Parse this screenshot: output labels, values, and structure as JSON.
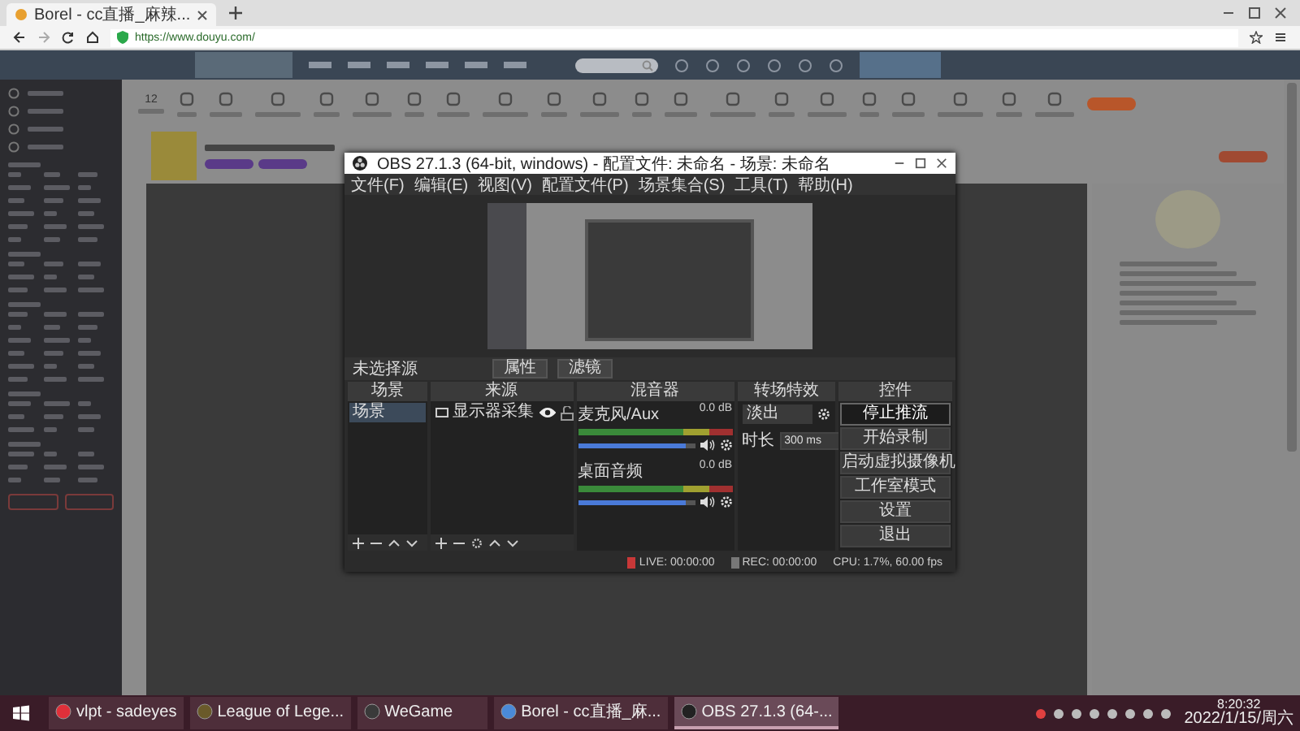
{
  "browser": {
    "tab_title": "Borel - cc直播_麻辣...",
    "url": "https://www.douyu.com/"
  },
  "site": {
    "stat": "12"
  },
  "obs": {
    "title": "OBS 27.1.3 (64-bit, windows) - 配置文件: 未命名 - 场景: 未命名",
    "menu": [
      "文件(F)",
      "编辑(E)",
      "视图(V)",
      "配置文件(P)",
      "场景集合(S)",
      "工具(T)",
      "帮助(H)"
    ],
    "source_bar": {
      "label": "未选择源",
      "buttons": [
        "属性",
        "滤镜"
      ]
    },
    "docks": [
      "场景",
      "来源",
      "混音器",
      "转场特效",
      "控件"
    ],
    "scenes": [
      {
        "label": "场景",
        "selected": true
      }
    ],
    "sources": [
      {
        "label": "显示器采集",
        "visible": true,
        "locked": false
      }
    ],
    "mixer": [
      {
        "name": "麦克风/Aux",
        "reading": "0.0 dB",
        "level": 0.92
      },
      {
        "name": "桌面音频",
        "reading": "0.0 dB",
        "level": 0.92
      }
    ],
    "transition": {
      "mode": "淡出",
      "duration_label": "时长",
      "duration": "300 ms"
    },
    "controls": [
      {
        "label": "停止推流",
        "selected": true
      },
      {
        "label": "开始录制",
        "selected": false
      },
      {
        "label": "启动虚拟摄像机",
        "selected": false
      },
      {
        "label": "工作室模式",
        "selected": false
      },
      {
        "label": "设置",
        "selected": false
      },
      {
        "label": "退出",
        "selected": false
      }
    ],
    "status": [
      {
        "kind": "live",
        "text": "LIVE: 00:00:00"
      },
      {
        "kind": "rec",
        "text": "REC: 00:00:00"
      },
      {
        "kind": "cpu",
        "text": "CPU: 1.7%, 60.00 fps"
      }
    ]
  },
  "taskbar": {
    "apps": [
      {
        "label": "vlpt - sadeyes",
        "selected": false
      },
      {
        "label": "League of Lege...",
        "selected": false
      },
      {
        "label": "WeGame",
        "selected": false
      },
      {
        "label": "Borel - cc直播_麻...",
        "selected": false
      },
      {
        "label": "OBS 27.1.3 (64-...",
        "selected": true
      }
    ],
    "time": "8:20:32",
    "date": "2022/1/15/周六"
  }
}
